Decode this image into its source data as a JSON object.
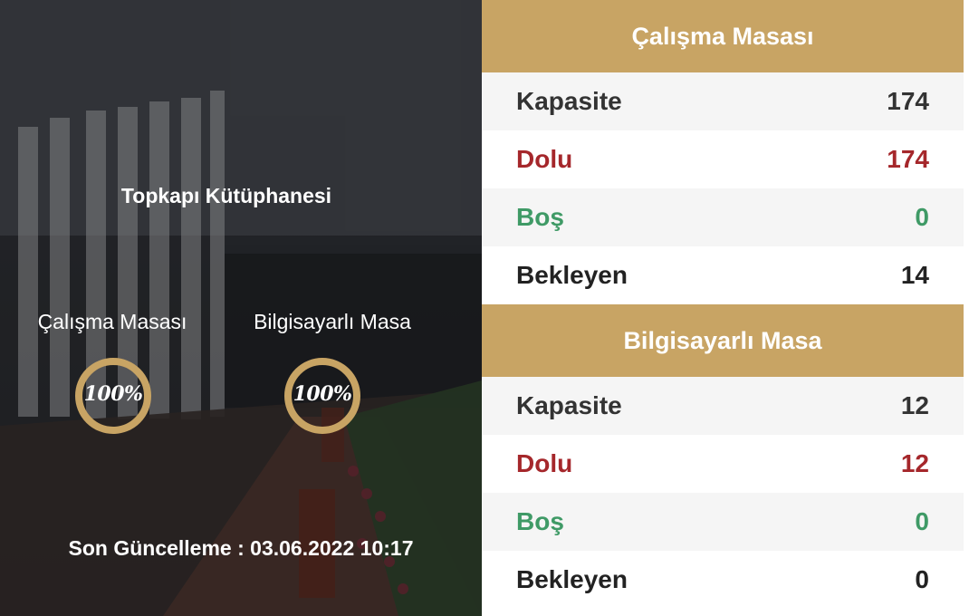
{
  "library": {
    "title": "Topkapı Kütüphanesi",
    "gauges": [
      {
        "label": "Çalışma Masası",
        "percent_text": "100%",
        "percent": 100
      },
      {
        "label": "Bilgisayarlı Masa",
        "percent_text": "100%",
        "percent": 100
      }
    ],
    "last_updated": "Son Güncelleme : 03.06.2022 10:17"
  },
  "sections": [
    {
      "title": "Çalışma Masası",
      "rows": [
        {
          "label": "Kapasite",
          "value": "174"
        },
        {
          "label": "Dolu",
          "value": "174"
        },
        {
          "label": "Boş",
          "value": "0"
        },
        {
          "label": "Bekleyen",
          "value": "14"
        }
      ]
    },
    {
      "title": "Bilgisayarlı Masa",
      "rows": [
        {
          "label": "Kapasite",
          "value": "12"
        },
        {
          "label": "Dolu",
          "value": "12"
        },
        {
          "label": "Boş",
          "value": "0"
        },
        {
          "label": "Bekleyen",
          "value": "0"
        }
      ]
    }
  ],
  "colors": {
    "accent": "#c8a464",
    "dolu": "#a5272b",
    "bos": "#3f9a66",
    "text": "#333333"
  }
}
